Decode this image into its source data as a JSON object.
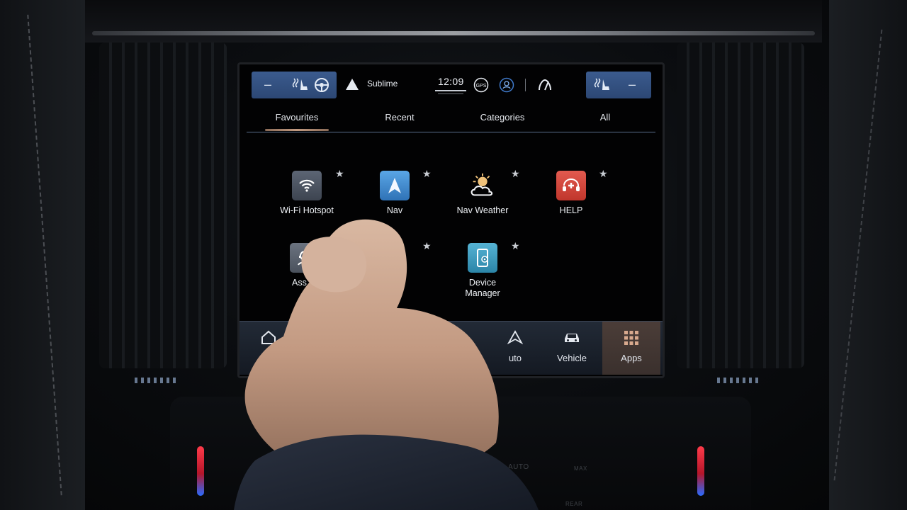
{
  "statusbar": {
    "road_name": "Sublime",
    "clock": "12:09",
    "left_seat_minus": "–",
    "right_seat_minus": "–"
  },
  "tabs": [
    {
      "label": "Favourites",
      "active": true
    },
    {
      "label": "Recent",
      "active": false
    },
    {
      "label": "Categories",
      "active": false
    },
    {
      "label": "All",
      "active": false
    }
  ],
  "apps": [
    {
      "label": "Wi-Fi Hotspot",
      "icon": "wifi-icon",
      "color": "#4a5260",
      "favourite": true
    },
    {
      "label": "Nav",
      "icon": "navigation-arrow-icon",
      "color": "#3f86c6",
      "favourite": true
    },
    {
      "label": "Nav Weather",
      "icon": "weather-icon",
      "color": "transparent",
      "favourite": true
    },
    {
      "label": "HELP",
      "icon": "help-cross-icon",
      "color": "#d0443a",
      "favourite": true
    },
    {
      "label": "Ass",
      "icon": "assistant-icon",
      "color": "#5c6470",
      "favourite": false
    },
    {
      "label": "",
      "icon": "",
      "color": "",
      "favourite": true
    },
    {
      "label": "Device\nManager",
      "icon": "device-manager-icon",
      "color": "#3a8fb0",
      "favourite": true
    }
  ],
  "stars": "★",
  "dock": [
    {
      "label": "Ho",
      "icon": "home-icon"
    },
    {
      "label": "uto",
      "icon": "android-auto-icon"
    },
    {
      "label": "Vehicle",
      "icon": "car-icon"
    },
    {
      "label": "Apps",
      "icon": "apps-grid-icon",
      "active": true
    }
  ],
  "climate": {
    "auto_label": "AUTO",
    "max_label": "MAX",
    "rear_label": "REAR"
  },
  "colors": {
    "accent_blue": "#3b5b8e",
    "tab_indicator": "#c29a80",
    "apps_active_bg": "#4b3d38"
  }
}
